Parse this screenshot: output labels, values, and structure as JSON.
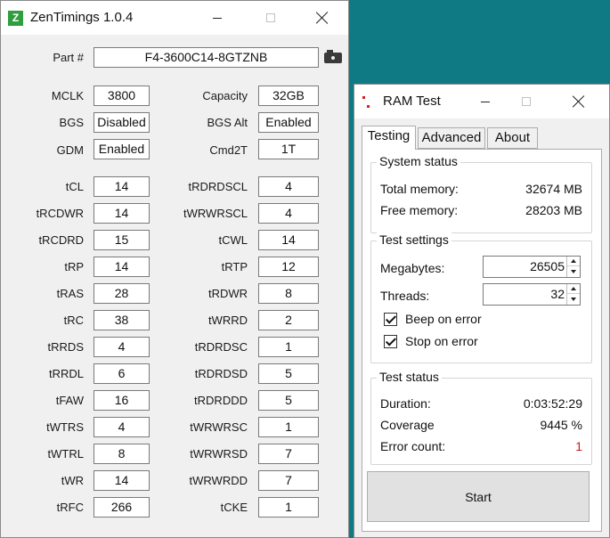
{
  "zentimings": {
    "title": "ZenTimings 1.0.4",
    "logo_letter": "Z",
    "part_label": "Part #",
    "part_value": "F4-3600C14-8GTZNB",
    "top_left": [
      {
        "label": "MCLK",
        "value": "3800"
      },
      {
        "label": "BGS",
        "value": "Disabled"
      },
      {
        "label": "GDM",
        "value": "Enabled"
      }
    ],
    "top_right": [
      {
        "label": "Capacity",
        "value": "32GB"
      },
      {
        "label": "BGS Alt",
        "value": "Enabled"
      },
      {
        "label": "Cmd2T",
        "value": "1T"
      }
    ],
    "timings_left": [
      {
        "label": "tCL",
        "value": "14"
      },
      {
        "label": "tRCDWR",
        "value": "14"
      },
      {
        "label": "tRCDRD",
        "value": "15"
      },
      {
        "label": "tRP",
        "value": "14"
      },
      {
        "label": "tRAS",
        "value": "28"
      },
      {
        "label": "tRC",
        "value": "38"
      },
      {
        "label": "tRRDS",
        "value": "4"
      },
      {
        "label": "tRRDL",
        "value": "6"
      },
      {
        "label": "tFAW",
        "value": "16"
      },
      {
        "label": "tWTRS",
        "value": "4"
      },
      {
        "label": "tWTRL",
        "value": "8"
      },
      {
        "label": "tWR",
        "value": "14"
      },
      {
        "label": "tRFC",
        "value": "266"
      }
    ],
    "timings_right": [
      {
        "label": "tRDRDSCL",
        "value": "4"
      },
      {
        "label": "tWRWRSCL",
        "value": "4"
      },
      {
        "label": "tCWL",
        "value": "14"
      },
      {
        "label": "tRTP",
        "value": "12"
      },
      {
        "label": "tRDWR",
        "value": "8"
      },
      {
        "label": "tWRRD",
        "value": "2"
      },
      {
        "label": "tRDRDSC",
        "value": "1"
      },
      {
        "label": "tRDRDSD",
        "value": "5"
      },
      {
        "label": "tRDRDDD",
        "value": "5"
      },
      {
        "label": "tWRWRSC",
        "value": "1"
      },
      {
        "label": "tWRWRSD",
        "value": "7"
      },
      {
        "label": "tWRWRDD",
        "value": "7"
      },
      {
        "label": "tCKE",
        "value": "1"
      }
    ]
  },
  "ramtest": {
    "title": "RAM Test",
    "tabs": [
      "Testing",
      "Advanced",
      "About"
    ],
    "system_status": {
      "title": "System status",
      "total_label": "Total memory:",
      "total_value": "32674 MB",
      "free_label": "Free memory:",
      "free_value": "28203 MB"
    },
    "test_settings": {
      "title": "Test settings",
      "megabytes_label": "Megabytes:",
      "megabytes_value": "26505",
      "threads_label": "Threads:",
      "threads_value": "32",
      "beep_label": "Beep on error",
      "stop_label": "Stop on error"
    },
    "test_status": {
      "title": "Test status",
      "duration_label": "Duration:",
      "duration_value": "0:03:52:29",
      "coverage_label": "Coverage",
      "coverage_value": "9445 %",
      "errors_label": "Error count:",
      "errors_value": "1"
    },
    "start_label": "Start"
  },
  "colors": {
    "desktop": "#0f7a84",
    "zentimings_logo": "#2e9e3e",
    "error_red": "#c41e1e"
  }
}
